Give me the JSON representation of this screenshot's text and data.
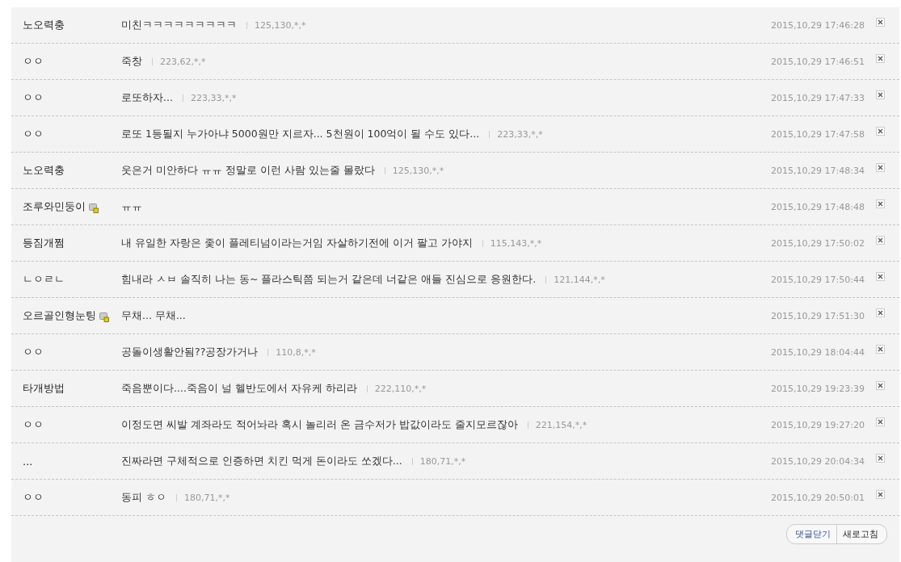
{
  "comments": [
    {
      "nick": "노오력충",
      "nick_icon": false,
      "text": "미친ㅋㅋㅋㅋㅋㅋㅋㅋㅋ",
      "ip": "125,130,*,*",
      "date": "2015,10,29 17:46:28"
    },
    {
      "nick": "ㅇㅇ",
      "nick_icon": false,
      "text": "죽창",
      "ip": "223,62,*,*",
      "date": "2015,10,29 17:46:51"
    },
    {
      "nick": "ㅇㅇ",
      "nick_icon": false,
      "text": "로또하자...",
      "ip": "223,33,*,*",
      "date": "2015,10,29 17:47:33"
    },
    {
      "nick": "ㅇㅇ",
      "nick_icon": false,
      "text": "로또 1등될지 누가아냐 5000원만 지르자... 5천원이 100억이 될 수도 있다...",
      "ip": "223,33,*,*",
      "date": "2015,10,29 17:47:58"
    },
    {
      "nick": "노오력충",
      "nick_icon": false,
      "text": "웃은거 미안하다 ㅠㅠ 정말로 이런 사람 있는줄 몰랐다",
      "ip": "125,130,*,*",
      "date": "2015,10,29 17:48:34"
    },
    {
      "nick": "조루와민둥이",
      "nick_icon": true,
      "text": "ㅠㅠ",
      "date": "2015,10,29 17:48:48"
    },
    {
      "nick": "등짐개쩜",
      "nick_icon": false,
      "text": "내 유일한 자랑은 좇이 플레티넘이라는거임 자살하기전에 이거 팔고 가야지",
      "ip": "115,143,*,*",
      "date": "2015,10,29 17:50:02"
    },
    {
      "nick": "ㄴㅇㄹㄴ",
      "nick_icon": false,
      "text": "힘내라 ㅅㅂ 솔직히 나는 동~ 플라스틱쯤 되는거 같은데 너같은 애들 진심으로 응원한다.",
      "ip": "121,144,*,*",
      "date": "2015,10,29 17:50:44"
    },
    {
      "nick": "오르골인형눈팅",
      "nick_icon": true,
      "text": "무채... 무채...",
      "date": "2015,10,29 17:51:30"
    },
    {
      "nick": "ㅇㅇ",
      "nick_icon": false,
      "text": "공돌이생활안됨??공장가거나",
      "ip": "110,8,*,*",
      "date": "2015,10,29 18:04:44"
    },
    {
      "nick": "타개방법",
      "nick_icon": false,
      "text": "죽음뿐이다....죽음이 널 헬반도에서 자유케 하리라",
      "ip": "222,110,*,*",
      "date": "2015,10,29 19:23:39"
    },
    {
      "nick": "ㅇㅇ",
      "nick_icon": false,
      "text": "이정도면 씨발 계좌라도 적어놔라 혹시 놀리러 온 금수저가 밥값이라도 줄지모르잖아",
      "ip": "221,154,*,*",
      "date": "2015,10,29 19:27:20"
    },
    {
      "nick": "...",
      "nick_icon": false,
      "text": "진짜라면 구체적으로 인증하면 치킨 먹게 돈이라도 쏘겠다...",
      "ip": "180,71,*,*",
      "date": "2015,10,29 20:04:34"
    },
    {
      "nick": "ㅇㅇ",
      "nick_icon": false,
      "text": "동피 ㅎㅇ",
      "ip": "180,71,*,*",
      "date": "2015,10,29 20:50:01"
    }
  ],
  "buttons": [
    {
      "label": "댓글닫기",
      "kind": "primary"
    },
    {
      "label": "새로고침",
      "kind": "plain"
    }
  ]
}
